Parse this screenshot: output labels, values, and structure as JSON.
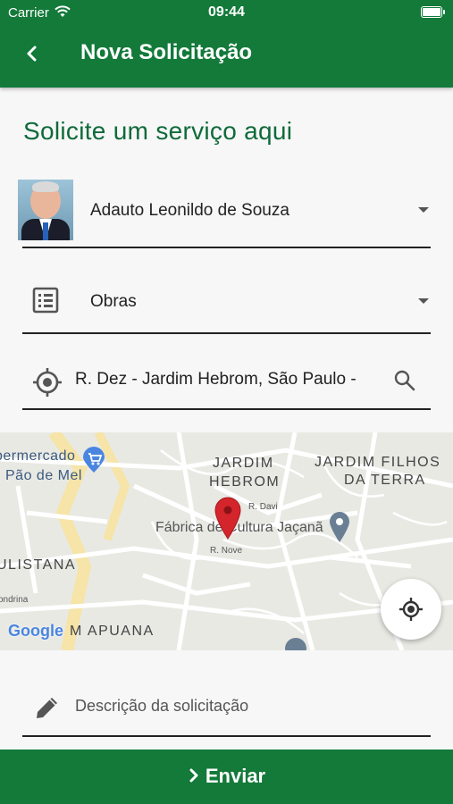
{
  "status_bar": {
    "carrier": "Carrier",
    "time": "09:44"
  },
  "header": {
    "title": "Nova Solicitação"
  },
  "page": {
    "heading": "Solicite um serviço aqui"
  },
  "form": {
    "representative": "Adauto Leonildo de Souza",
    "category": "Obras",
    "address": "R. Dez - Jardim Hebrom, São Paulo -",
    "description_placeholder": "Descrição da solicitação"
  },
  "map": {
    "labels": {
      "supermarket_line1": "permercado",
      "supermarket_line2": "Pão de Mel",
      "jardim_hebrom_1": "JARDIM",
      "jardim_hebrom_2": "HEBROM",
      "jardim_filhos_1": "JARDIM FILHOS",
      "jardim_filhos_2": "DA TERRA",
      "fabrica": "Fábrica de Cultura Jaçanã",
      "r_davi": "R. Davi",
      "r_nove": "R. Nove",
      "ulistana": "ULISTANA",
      "apuana": "M APUANA",
      "ondrina": "ondrina",
      "google_logo": "Google"
    }
  },
  "footer": {
    "send_label": "Enviar"
  },
  "colors": {
    "primary": "#137a3a",
    "heading": "#0f6a3a",
    "pin": "#d3252b"
  }
}
